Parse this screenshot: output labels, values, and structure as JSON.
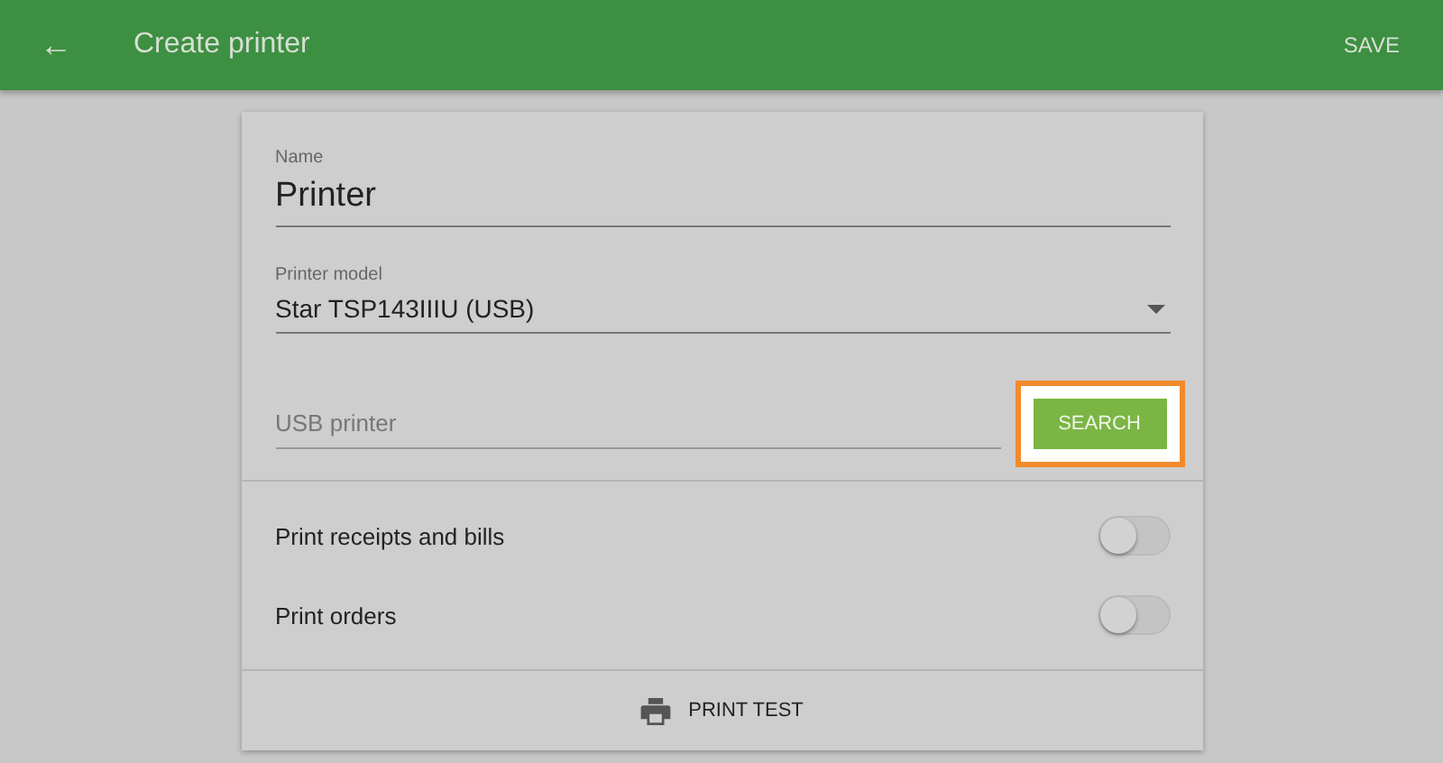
{
  "app_bar": {
    "back_icon": "←",
    "title": "Create printer",
    "action": "SAVE"
  },
  "form": {
    "name": {
      "label": "Name",
      "value": "Printer"
    },
    "model": {
      "label": "Printer model",
      "value": "Star TSP143IIIU (USB)"
    },
    "usb": {
      "placeholder": "USB printer"
    },
    "search_button": {
      "label": "SEARCH",
      "highlighted": true
    }
  },
  "toggles": [
    {
      "label": "Print receipts and bills",
      "on": false
    },
    {
      "label": "Print orders",
      "on": false
    }
  ],
  "print_test": {
    "label": "PRINT TEST"
  }
}
